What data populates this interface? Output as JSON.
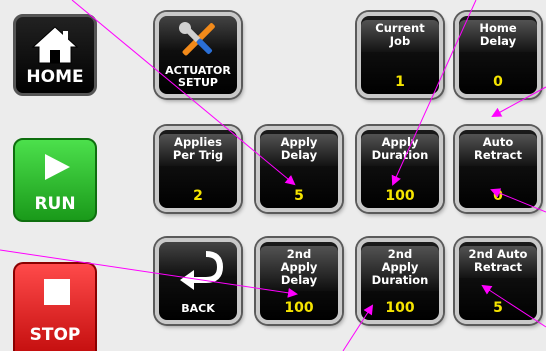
{
  "side": {
    "home_label": "HOME",
    "run_label": "RUN",
    "stop_label": "STOP"
  },
  "tiles": {
    "actuator_setup": {
      "line1": "ACTUATOR",
      "line2": "SETUP"
    },
    "current_job": {
      "line1": "Current",
      "line2": "Job",
      "value": "1"
    },
    "home_delay": {
      "line1": "Home",
      "line2": "Delay",
      "value": "0"
    },
    "applies_per_trig": {
      "line1": "Applies",
      "line2": "Per Trig",
      "value": "2"
    },
    "apply_delay": {
      "line1": "Apply",
      "line2": "Delay",
      "value": "5"
    },
    "apply_duration": {
      "line1": "Apply",
      "line2": "Duration",
      "value": "100"
    },
    "auto_retract": {
      "line1": "Auto",
      "line2": "Retract",
      "value": "0"
    },
    "back": {
      "label": "BACK"
    },
    "second_apply_delay": {
      "line1": "2nd",
      "line2": "Apply",
      "line3": "Delay",
      "value": "100"
    },
    "second_apply_duration": {
      "line1": "2nd",
      "line2": "Apply",
      "line3": "Duration",
      "value": "100"
    },
    "second_auto_retract": {
      "line1": "2nd Auto",
      "line2": "Retract",
      "value": "5"
    }
  },
  "colors": {
    "value_text": "#f5e400",
    "callout_line": "#ff00ff"
  }
}
